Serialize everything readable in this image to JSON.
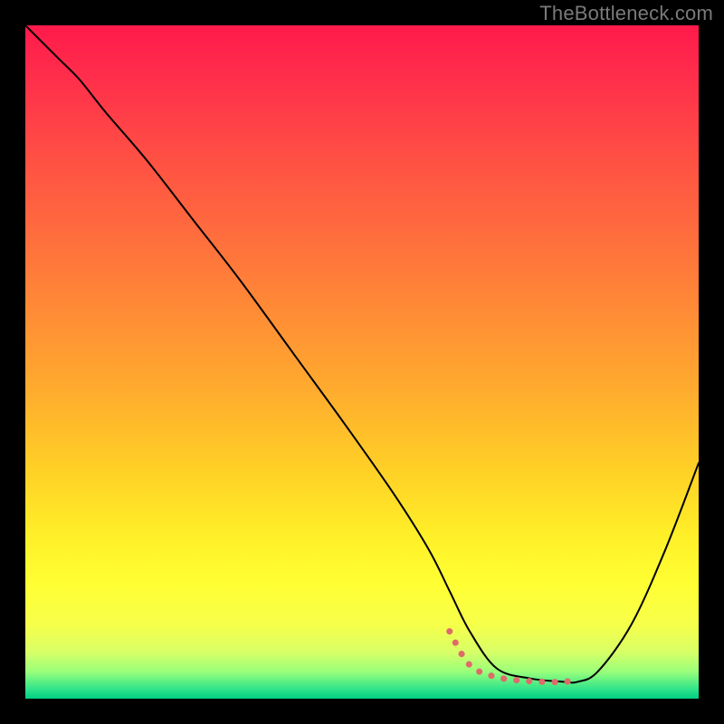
{
  "watermark": "TheBottleneck.com",
  "chart_data": {
    "type": "line",
    "title": "",
    "xlabel": "",
    "ylabel": "",
    "xlim": [
      0,
      100
    ],
    "ylim": [
      0,
      100
    ],
    "grid": false,
    "legend": false,
    "background_gradient_stops": [
      {
        "offset": 0.0,
        "color": "#ff1a4b"
      },
      {
        "offset": 0.08,
        "color": "#ff2f4b"
      },
      {
        "offset": 0.18,
        "color": "#ff4b45"
      },
      {
        "offset": 0.3,
        "color": "#ff6a3e"
      },
      {
        "offset": 0.42,
        "color": "#ff8a36"
      },
      {
        "offset": 0.54,
        "color": "#ffab2e"
      },
      {
        "offset": 0.66,
        "color": "#ffd026"
      },
      {
        "offset": 0.76,
        "color": "#fff028"
      },
      {
        "offset": 0.83,
        "color": "#ffff33"
      },
      {
        "offset": 0.89,
        "color": "#f6ff4a"
      },
      {
        "offset": 0.93,
        "color": "#d9ff66"
      },
      {
        "offset": 0.96,
        "color": "#99ff7a"
      },
      {
        "offset": 0.985,
        "color": "#33e58a"
      },
      {
        "offset": 1.0,
        "color": "#00d084"
      }
    ],
    "series": [
      {
        "name": "main-curve",
        "stroke": "#000000",
        "stroke_width": 2,
        "x": [
          0,
          2,
          5,
          8,
          12,
          18,
          25,
          32,
          40,
          48,
          55,
          60,
          63,
          66,
          70,
          75,
          80,
          82,
          85,
          90,
          95,
          100
        ],
        "y": [
          100,
          98,
          95,
          92,
          87,
          80,
          71,
          62,
          51,
          40,
          30,
          22,
          16,
          10,
          4.5,
          3,
          2.5,
          2.5,
          4,
          11,
          22,
          35
        ]
      }
    ],
    "highlight": {
      "name": "flat-region",
      "stroke": "#e06a6a",
      "stroke_width": 7,
      "linecap": "round",
      "dash": "0.1 14",
      "x": [
        63,
        66,
        70,
        75,
        80,
        82
      ],
      "y": [
        10,
        5,
        3.2,
        2.6,
        2.5,
        3
      ]
    }
  }
}
